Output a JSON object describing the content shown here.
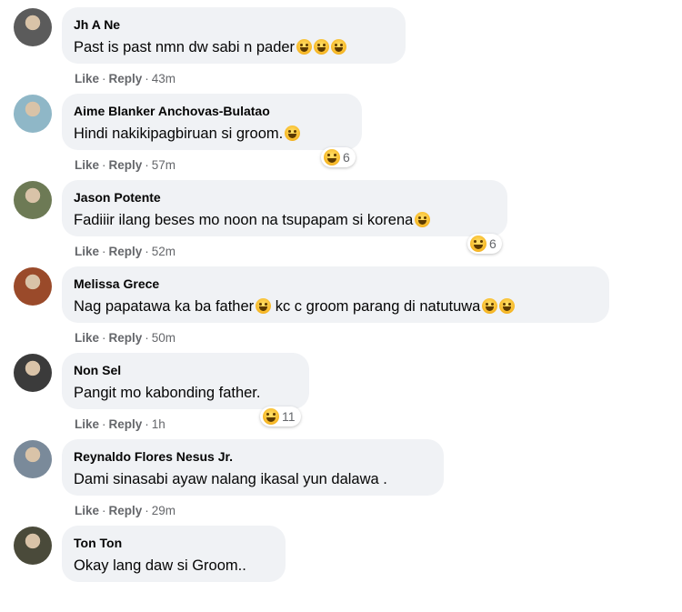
{
  "comments": [
    {
      "name": "Jh A Ne",
      "text": "Past is past nmn dw sabi n pader",
      "emojis": [
        "laughing-crying-emoji",
        "grinning-emoji",
        "smiling-emoji"
      ],
      "time": "43m",
      "reactions": null,
      "avatar_color": "#5b5b5b"
    },
    {
      "name": "Aime Blanker Anchovas-Bulatao",
      "text": "Hindi nakikipagbiruan si groom.",
      "emojis": [
        "laughing-crying-emoji"
      ],
      "time": "57m",
      "reactions": "6",
      "avatar_color": "#8fb7c7"
    },
    {
      "name": "Jason Potente",
      "text": "Fadiiir ilang beses mo noon na tsupapam si korena",
      "emojis": [
        "rolling-laughing-emoji"
      ],
      "time": "52m",
      "reactions": "6",
      "avatar_color": "#6d7a55"
    },
    {
      "name": "Melissa Grece",
      "text": "Nag papatawa ka ba father",
      "text2": " kc c groom parang di natutuwa",
      "emojis": [
        "laughing-emoji"
      ],
      "emojis2": [
        "laughing-emoji",
        "laughing-emoji"
      ],
      "time": "50m",
      "reactions": null,
      "avatar_color": "#9a4a2a"
    },
    {
      "name": "Non Sel",
      "text": "Pangit mo kabonding father.",
      "emojis": [],
      "time": "1h",
      "reactions": "11",
      "avatar_color": "#3b3b3b"
    },
    {
      "name": "Reynaldo Flores Nesus Jr.",
      "text": "Dami sinasabi ayaw nalang ikasal yun dalawa .",
      "emojis": [],
      "time": "29m",
      "reactions": null,
      "avatar_color": "#7a8a9a"
    },
    {
      "name": "Ton Ton",
      "text": "Okay lang daw si Groom..",
      "emojis": [],
      "time": "",
      "reactions": null,
      "avatar_color": "#4a4a3a"
    }
  ],
  "labels": {
    "like": "Like",
    "reply": "Reply",
    "dot": "·"
  }
}
